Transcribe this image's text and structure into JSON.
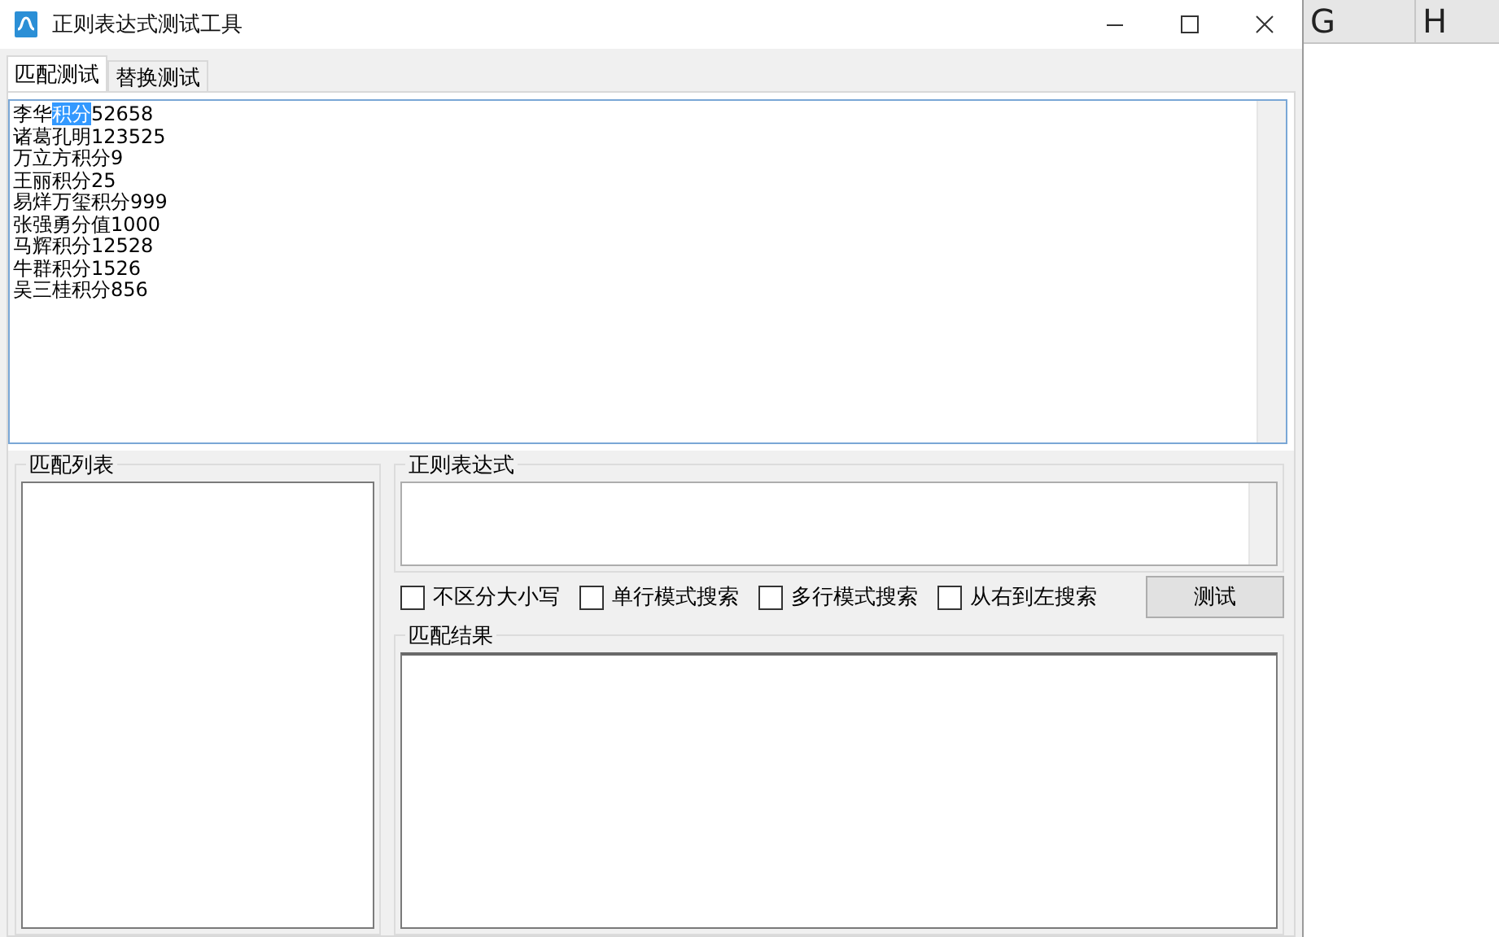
{
  "window": {
    "title": "正则表达式测试工具"
  },
  "tabs": [
    {
      "label": "匹配测试",
      "selected": true
    },
    {
      "label": "替换测试",
      "selected": false
    }
  ],
  "source_text": {
    "lines": [
      {
        "segments": [
          {
            "text": "李华",
            "selected": false
          },
          {
            "text": "积分",
            "selected": true
          },
          {
            "text": "52658",
            "selected": false
          }
        ]
      },
      {
        "segments": [
          {
            "text": "诸葛孔明123525",
            "selected": false
          }
        ]
      },
      {
        "segments": [
          {
            "text": "万立方积分9",
            "selected": false
          }
        ]
      },
      {
        "segments": [
          {
            "text": "王丽积分25",
            "selected": false
          }
        ]
      },
      {
        "segments": [
          {
            "text": "易烊万玺积分999",
            "selected": false
          }
        ]
      },
      {
        "segments": [
          {
            "text": "张强勇分值1000",
            "selected": false
          }
        ]
      },
      {
        "segments": [
          {
            "text": "马辉积分12528",
            "selected": false
          }
        ]
      },
      {
        "segments": [
          {
            "text": "牛群积分1526",
            "selected": false
          }
        ]
      },
      {
        "segments": [
          {
            "text": "吴三桂积分856",
            "selected": false
          }
        ]
      }
    ]
  },
  "match_list": {
    "title": "匹配列表"
  },
  "regex": {
    "title": "正则表达式"
  },
  "options": [
    {
      "label": "不区分大小写",
      "checked": false
    },
    {
      "label": "单行模式搜索",
      "checked": false
    },
    {
      "label": "多行模式搜索",
      "checked": false
    },
    {
      "label": "从右到左搜索",
      "checked": false
    }
  ],
  "test_button": "测试",
  "result": {
    "title": "匹配结果"
  },
  "background_sheet": {
    "columns": [
      "G",
      "H"
    ]
  }
}
